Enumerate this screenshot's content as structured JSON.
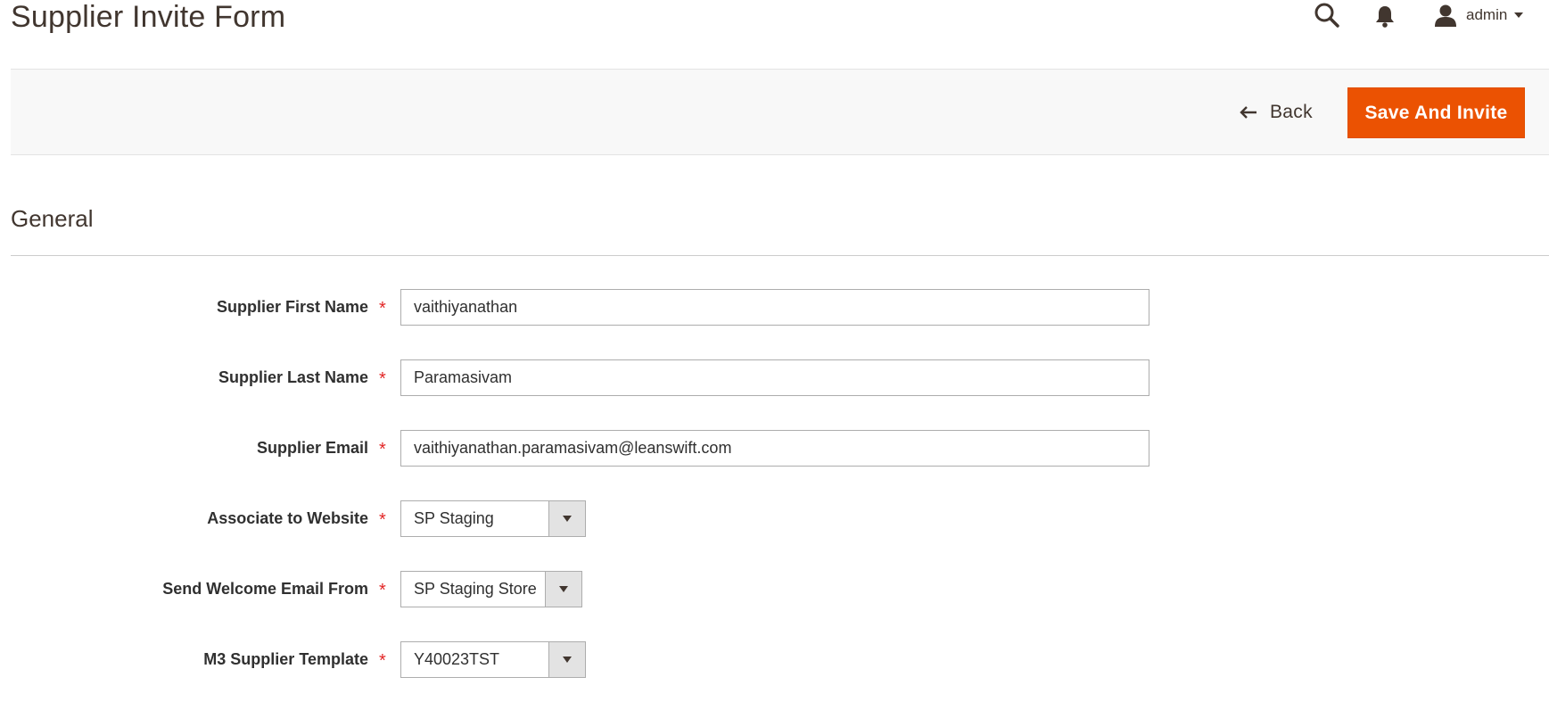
{
  "header": {
    "title": "Supplier Invite Form",
    "icons": [
      "search-icon",
      "bell-icon",
      "user-icon"
    ],
    "user_name": "admin"
  },
  "actions": {
    "back_label": "Back",
    "save_label": "Save And Invite"
  },
  "colors": {
    "primary_button": "#eb5202",
    "required_star": "#e22626",
    "action_bar_bg": "#f8f8f8"
  },
  "section": {
    "title": "General"
  },
  "form": {
    "first_name": {
      "label": "Supplier First Name",
      "value": "vaithiyanathan",
      "required_mark": "*"
    },
    "last_name": {
      "label": "Supplier Last Name",
      "value": "Paramasivam",
      "required_mark": "*"
    },
    "email": {
      "label": "Supplier Email",
      "value": "vaithiyanathan.paramasivam@leanswift.com",
      "required_mark": "*"
    },
    "website": {
      "label": "Associate to Website",
      "selected": "SP Staging",
      "required_mark": "*"
    },
    "welcome_email_from": {
      "label": "Send Welcome Email From",
      "selected": "SP Staging Store",
      "required_mark": "*"
    },
    "m3_template": {
      "label": "M3 Supplier Template",
      "selected": "Y40023TST",
      "required_mark": "*"
    }
  }
}
